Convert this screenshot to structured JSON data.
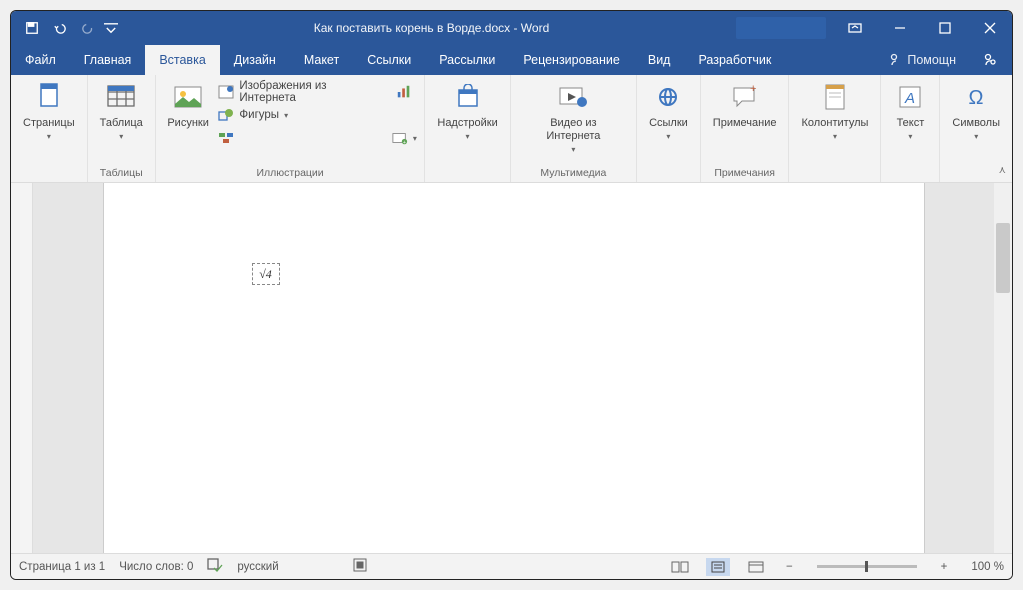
{
  "title": "Как поставить корень в Ворде.docx - Word",
  "tabs": {
    "file": "Файл",
    "home": "Главная",
    "insert": "Вставка",
    "design": "Дизайн",
    "layout": "Макет",
    "references": "Ссылки",
    "mailings": "Рассылки",
    "review": "Рецензирование",
    "view": "Вид",
    "developer": "Разработчик",
    "help": "Помощн"
  },
  "ribbon": {
    "groups": {
      "pages": {
        "btn": "Страницы",
        "label": ""
      },
      "tables": {
        "btn": "Таблица",
        "label": "Таблицы"
      },
      "illustrations": {
        "pictures": "Рисунки",
        "online_pictures": "Изображения из Интернета",
        "shapes": "Фигуры",
        "label": "Иллюстрации"
      },
      "addins": {
        "btn": "Надстройки",
        "label": ""
      },
      "media": {
        "btn": "Видео из Интернета",
        "label": "Мультимедиа"
      },
      "links": {
        "btn": "Ссылки",
        "label": ""
      },
      "comments": {
        "btn": "Примечание",
        "label": "Примечания"
      },
      "header_footer": {
        "btn": "Колонтитулы",
        "label": ""
      },
      "text": {
        "btn": "Текст",
        "label": ""
      },
      "symbols": {
        "btn": "Символы",
        "label": ""
      }
    }
  },
  "document": {
    "equation_display": "√4"
  },
  "statusbar": {
    "page": "Страница 1 из 1",
    "words": "Число слов: 0",
    "lang": "русский",
    "zoom": "100 %"
  }
}
